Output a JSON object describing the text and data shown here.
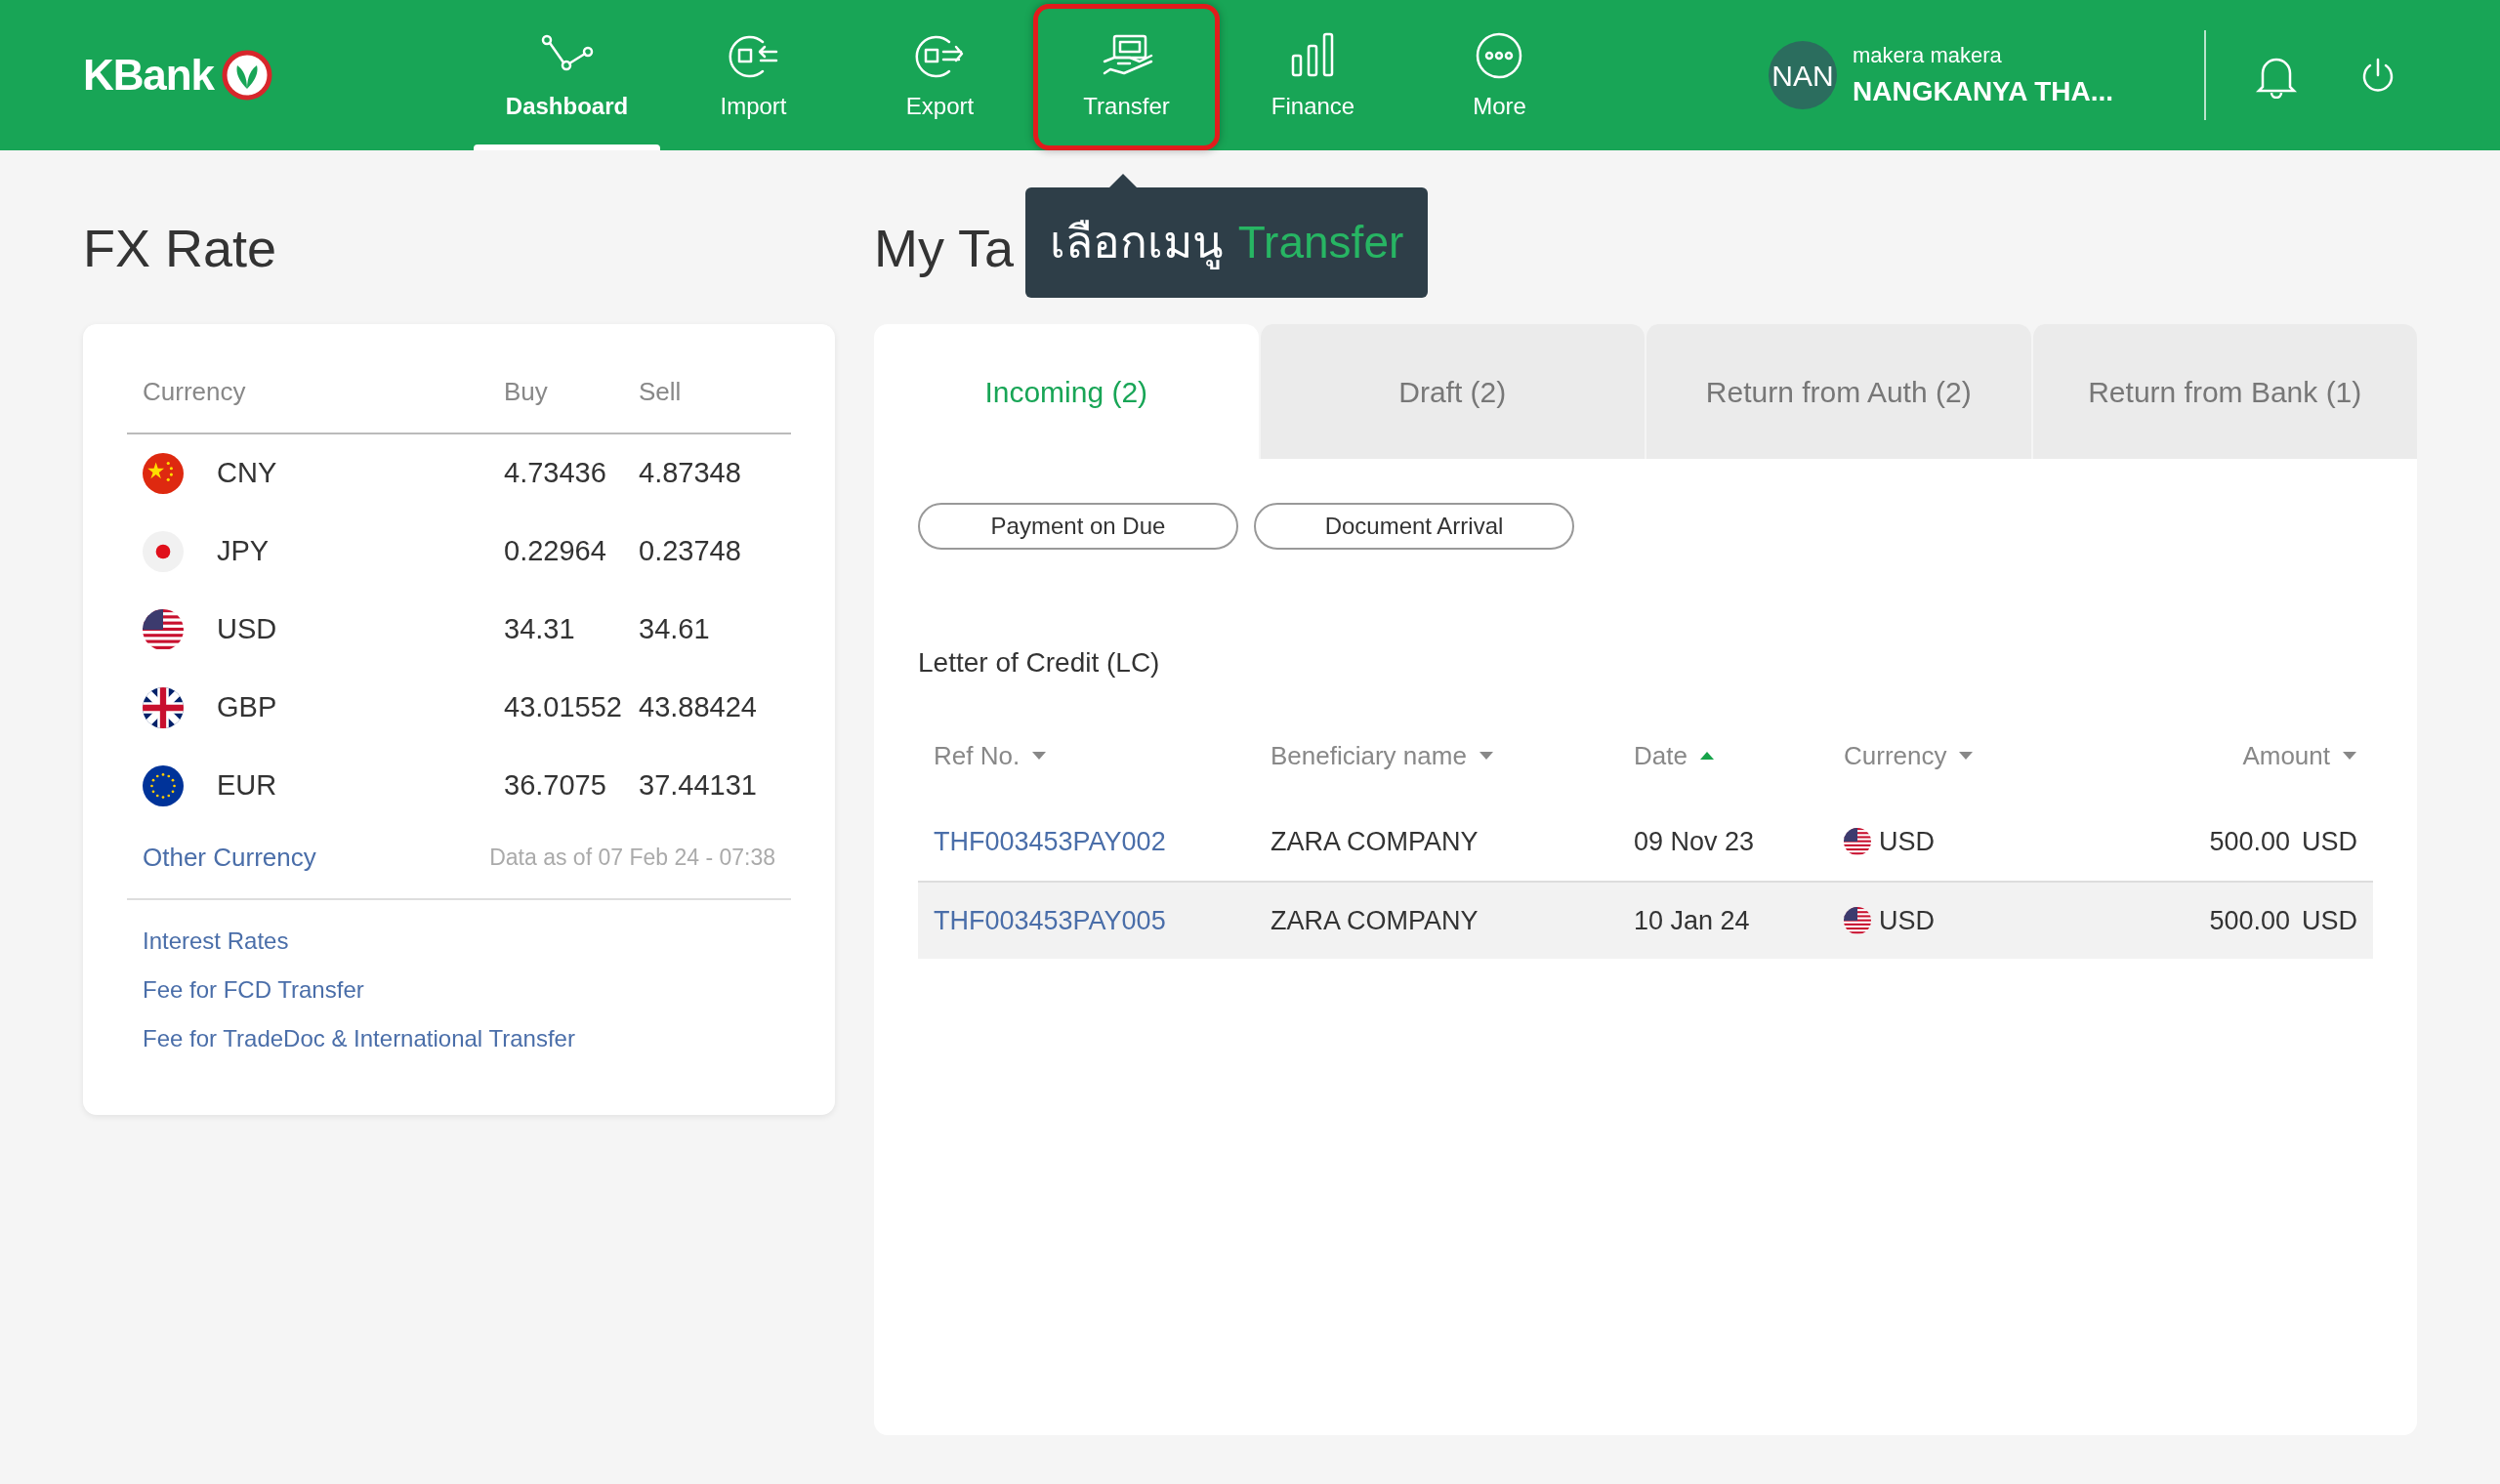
{
  "header": {
    "logo": "KBank",
    "nav": [
      {
        "label": "Dashboard",
        "kind": "route",
        "selected": true,
        "highlighted": false
      },
      {
        "label": "Import",
        "kind": "import",
        "selected": false,
        "highlighted": false
      },
      {
        "label": "Export",
        "kind": "export",
        "selected": false,
        "highlighted": false
      },
      {
        "label": "Transfer",
        "kind": "transfer",
        "selected": false,
        "highlighted": true
      },
      {
        "label": "Finance",
        "kind": "bars",
        "selected": false,
        "highlighted": false
      },
      {
        "label": "More",
        "kind": "more",
        "selected": false,
        "highlighted": false
      }
    ],
    "user": {
      "initials": "NAN",
      "role": "makera makera",
      "name": "NANGKANYA THA..."
    }
  },
  "tooltip": {
    "text": "เลือกเมนู",
    "highlight": "Transfer"
  },
  "fx": {
    "title": "FX Rate",
    "columns": [
      "Currency",
      "Buy",
      "Sell"
    ],
    "rows": [
      {
        "kind": "cn",
        "code": "CNY",
        "buy": "4.73436",
        "sell": "4.87348"
      },
      {
        "kind": "jp",
        "code": "JPY",
        "buy": "0.22964",
        "sell": "0.23748"
      },
      {
        "kind": "us",
        "code": "USD",
        "buy": "34.31",
        "sell": "34.61"
      },
      {
        "kind": "gb",
        "code": "GBP",
        "buy": "43.01552",
        "sell": "43.88424"
      },
      {
        "kind": "eu",
        "code": "EUR",
        "buy": "36.7075",
        "sell": "37.44131"
      }
    ],
    "other_link": "Other Currency",
    "data_as_of": "Data as of 07 Feb 24 - 07:38",
    "links": [
      "Interest Rates",
      "Fee for FCD Transfer",
      "Fee for TradeDoc & International Transfer"
    ]
  },
  "tasks": {
    "title": "My Ta",
    "tabs": [
      {
        "label": "Incoming (2)",
        "selected": true
      },
      {
        "label": "Draft (2)",
        "selected": false
      },
      {
        "label": "Return from Auth (2)",
        "selected": false
      },
      {
        "label": "Return from Bank (1)",
        "selected": false
      }
    ],
    "filters": [
      "Payment on Due",
      "Document Arrival"
    ],
    "section": "Letter of Credit (LC)",
    "columns": [
      {
        "label": "Ref No.",
        "ascending": false,
        "active": false
      },
      {
        "label": "Beneficiary name",
        "ascending": false,
        "active": false
      },
      {
        "label": "Date",
        "ascending": true,
        "active": true
      },
      {
        "label": "Currency",
        "ascending": false,
        "active": false
      },
      {
        "label": "Amount",
        "ascending": false,
        "active": false
      }
    ],
    "rows": [
      {
        "ref": "THF003453PAY002",
        "beneficiary": "ZARA COMPANY",
        "date": "09 Nov 23",
        "currency": "USD",
        "amount": "500.00",
        "amount_currency": "USD",
        "selected": false
      },
      {
        "ref": "THF003453PAY005",
        "beneficiary": "ZARA COMPANY",
        "date": "10 Jan 24",
        "currency": "USD",
        "amount": "500.00",
        "amount_currency": "USD",
        "selected": true
      }
    ]
  }
}
